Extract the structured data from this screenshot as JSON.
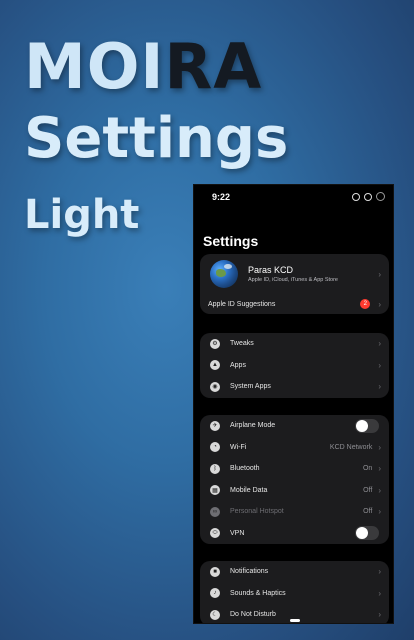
{
  "promo": {
    "title_part1": "MOI",
    "title_part2": "RA",
    "subtitle": "Settings",
    "variant": "Light"
  },
  "status": {
    "time": "9:22"
  },
  "page_title": "Settings",
  "profile": {
    "name": "Paras KCD",
    "subtitle": "Apple ID, iCloud, iTunes & App Store"
  },
  "suggestions": {
    "label": "Apple ID Suggestions",
    "badge": "2"
  },
  "group1": [
    {
      "label": "Tweaks",
      "icon": "tweaks-icon"
    },
    {
      "label": "Apps",
      "icon": "apps-icon"
    },
    {
      "label": "System Apps",
      "icon": "system-apps-icon"
    }
  ],
  "group2": [
    {
      "label": "Airplane Mode",
      "icon": "airplane-icon",
      "toggle": false
    },
    {
      "label": "Wi-Fi",
      "icon": "wifi-icon",
      "value": "KCD Network"
    },
    {
      "label": "Bluetooth",
      "icon": "bluetooth-icon",
      "value": "On"
    },
    {
      "label": "Mobile Data",
      "icon": "mobile-data-icon",
      "value": "Off"
    },
    {
      "label": "Personal Hotspot",
      "icon": "hotspot-icon",
      "value": "Off",
      "disabled": true
    },
    {
      "label": "VPN",
      "icon": "vpn-icon",
      "toggle": false
    }
  ],
  "group3": [
    {
      "label": "Notifications",
      "icon": "notifications-icon"
    },
    {
      "label": "Sounds & Haptics",
      "icon": "sounds-icon"
    },
    {
      "label": "Do Not Disturb",
      "icon": "moon-icon"
    }
  ],
  "colors": {
    "background": "#2f6da3",
    "panel": "#1c1c1e",
    "badge": "#ff3b30"
  }
}
